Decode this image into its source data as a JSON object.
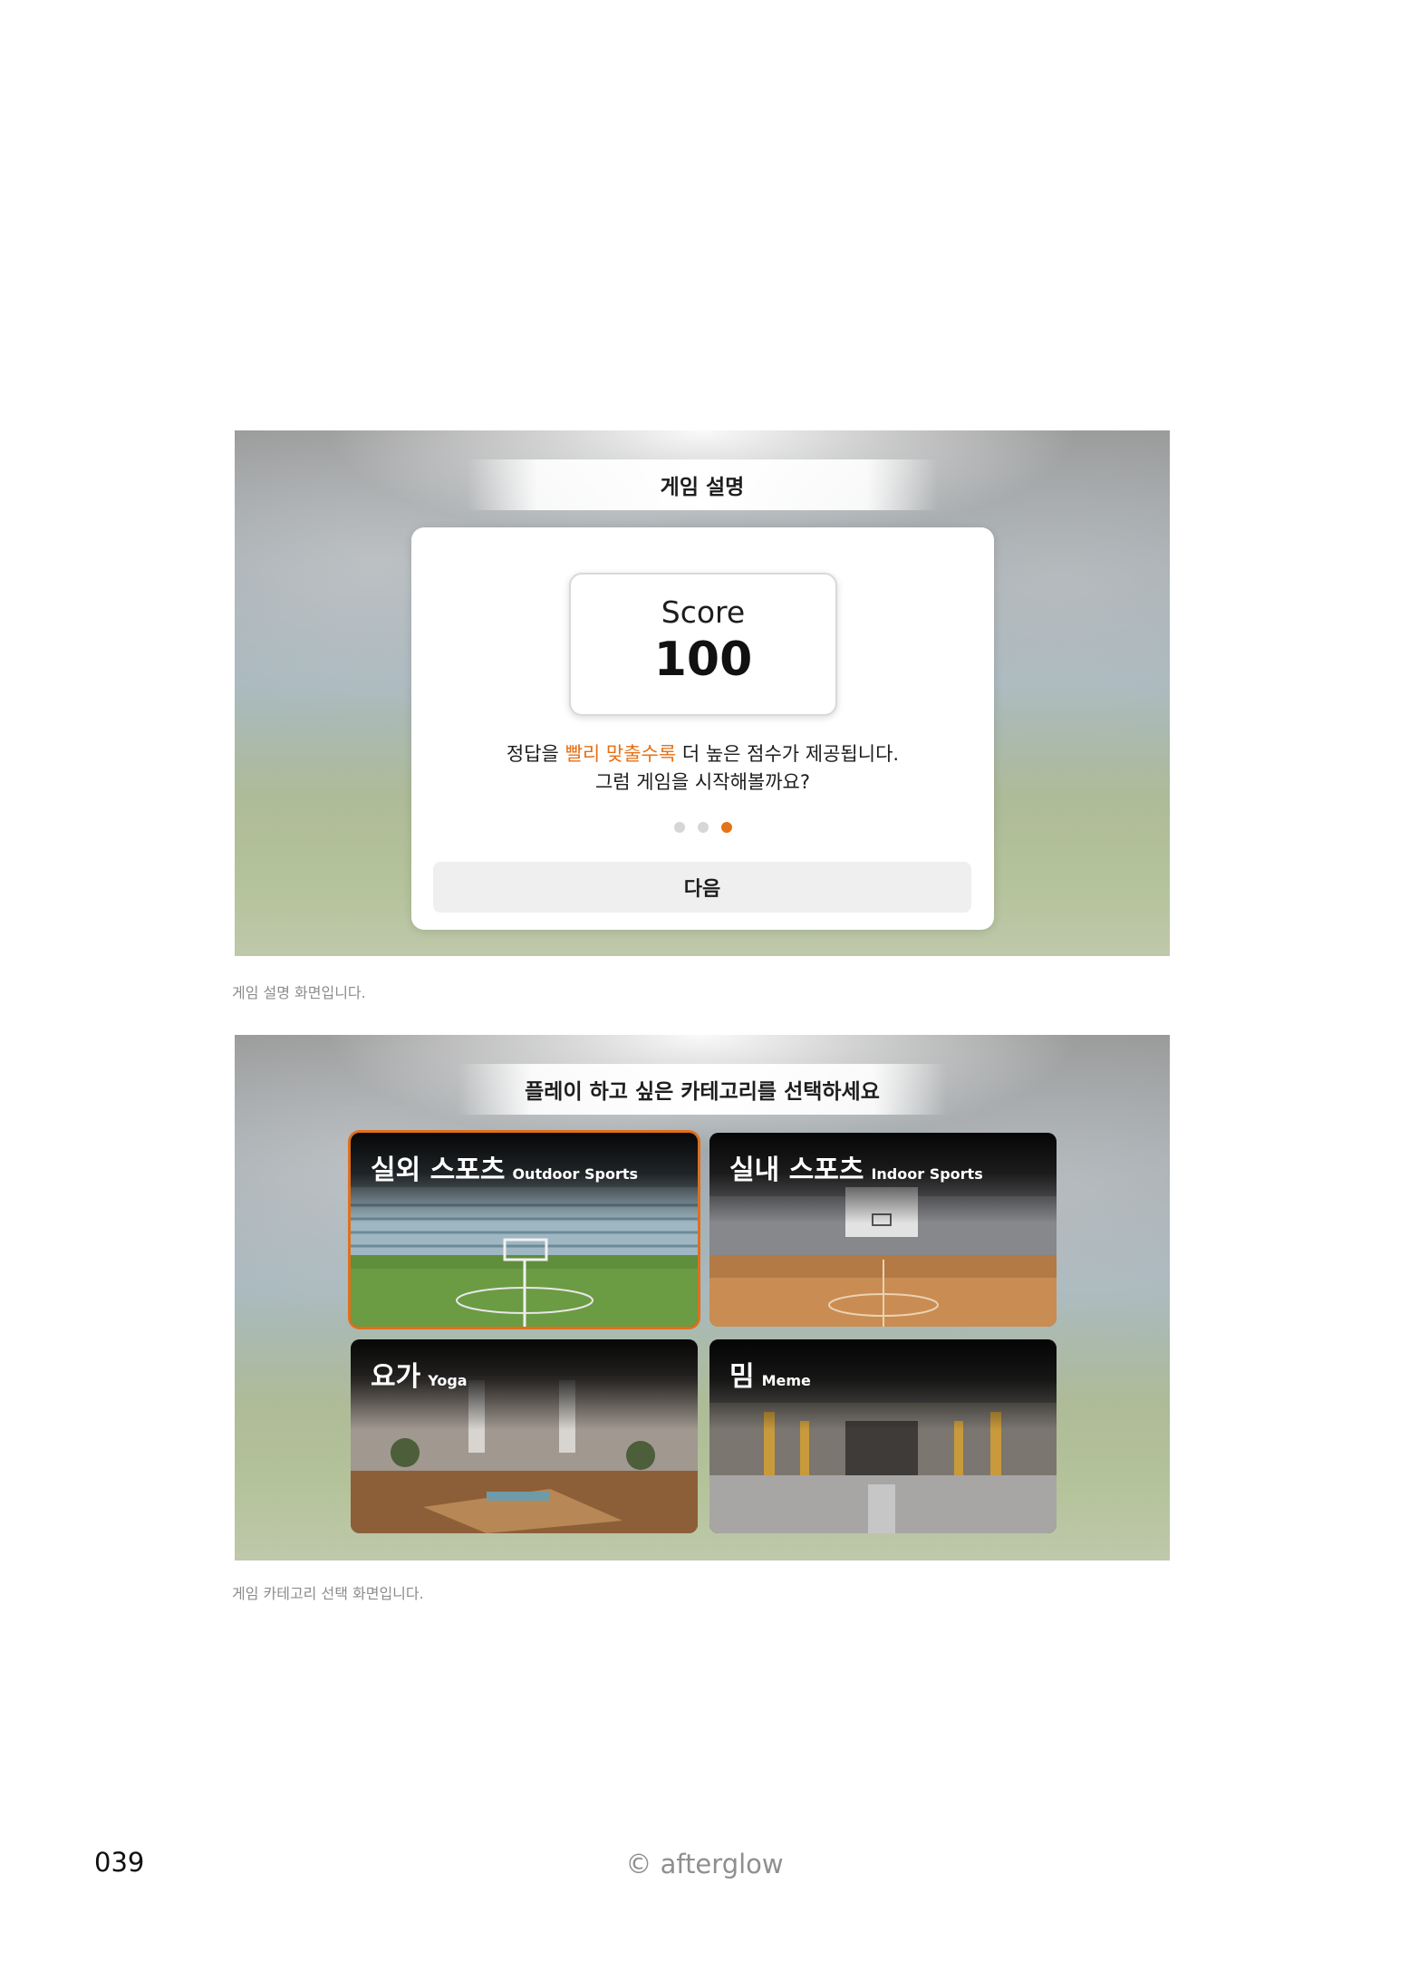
{
  "screen1": {
    "title": "게임 설명",
    "score": {
      "label": "Score",
      "value": "100"
    },
    "description": {
      "line1_before": "정답을 ",
      "line1_highlight": "빨리 맞출수록",
      "line1_after": " 더 높은 점수가 제공됩니다.",
      "line2": "그럼 게임을 시작해볼까요?"
    },
    "pagination": {
      "total": 3,
      "active": 3
    },
    "next_button": "다음",
    "caption": "게임 설명 화면입니다."
  },
  "screen2": {
    "title": "플레이 하고 싶은 카테고리를 선택하세요",
    "categories": [
      {
        "ko": "실외 스포츠",
        "en": "Outdoor Sports",
        "selected": true
      },
      {
        "ko": "실내 스포츠",
        "en": "Indoor Sports",
        "selected": false
      },
      {
        "ko": "요가",
        "en": "Yoga",
        "selected": false
      },
      {
        "ko": "밈",
        "en": "Meme",
        "selected": false
      }
    ],
    "caption": "게임 카테고리 선택 화면입니다."
  },
  "footer": {
    "page_number": "039",
    "copyright": "© afterglow"
  },
  "colors": {
    "accent": "#e57218",
    "selected_border": "#e06f1c"
  }
}
